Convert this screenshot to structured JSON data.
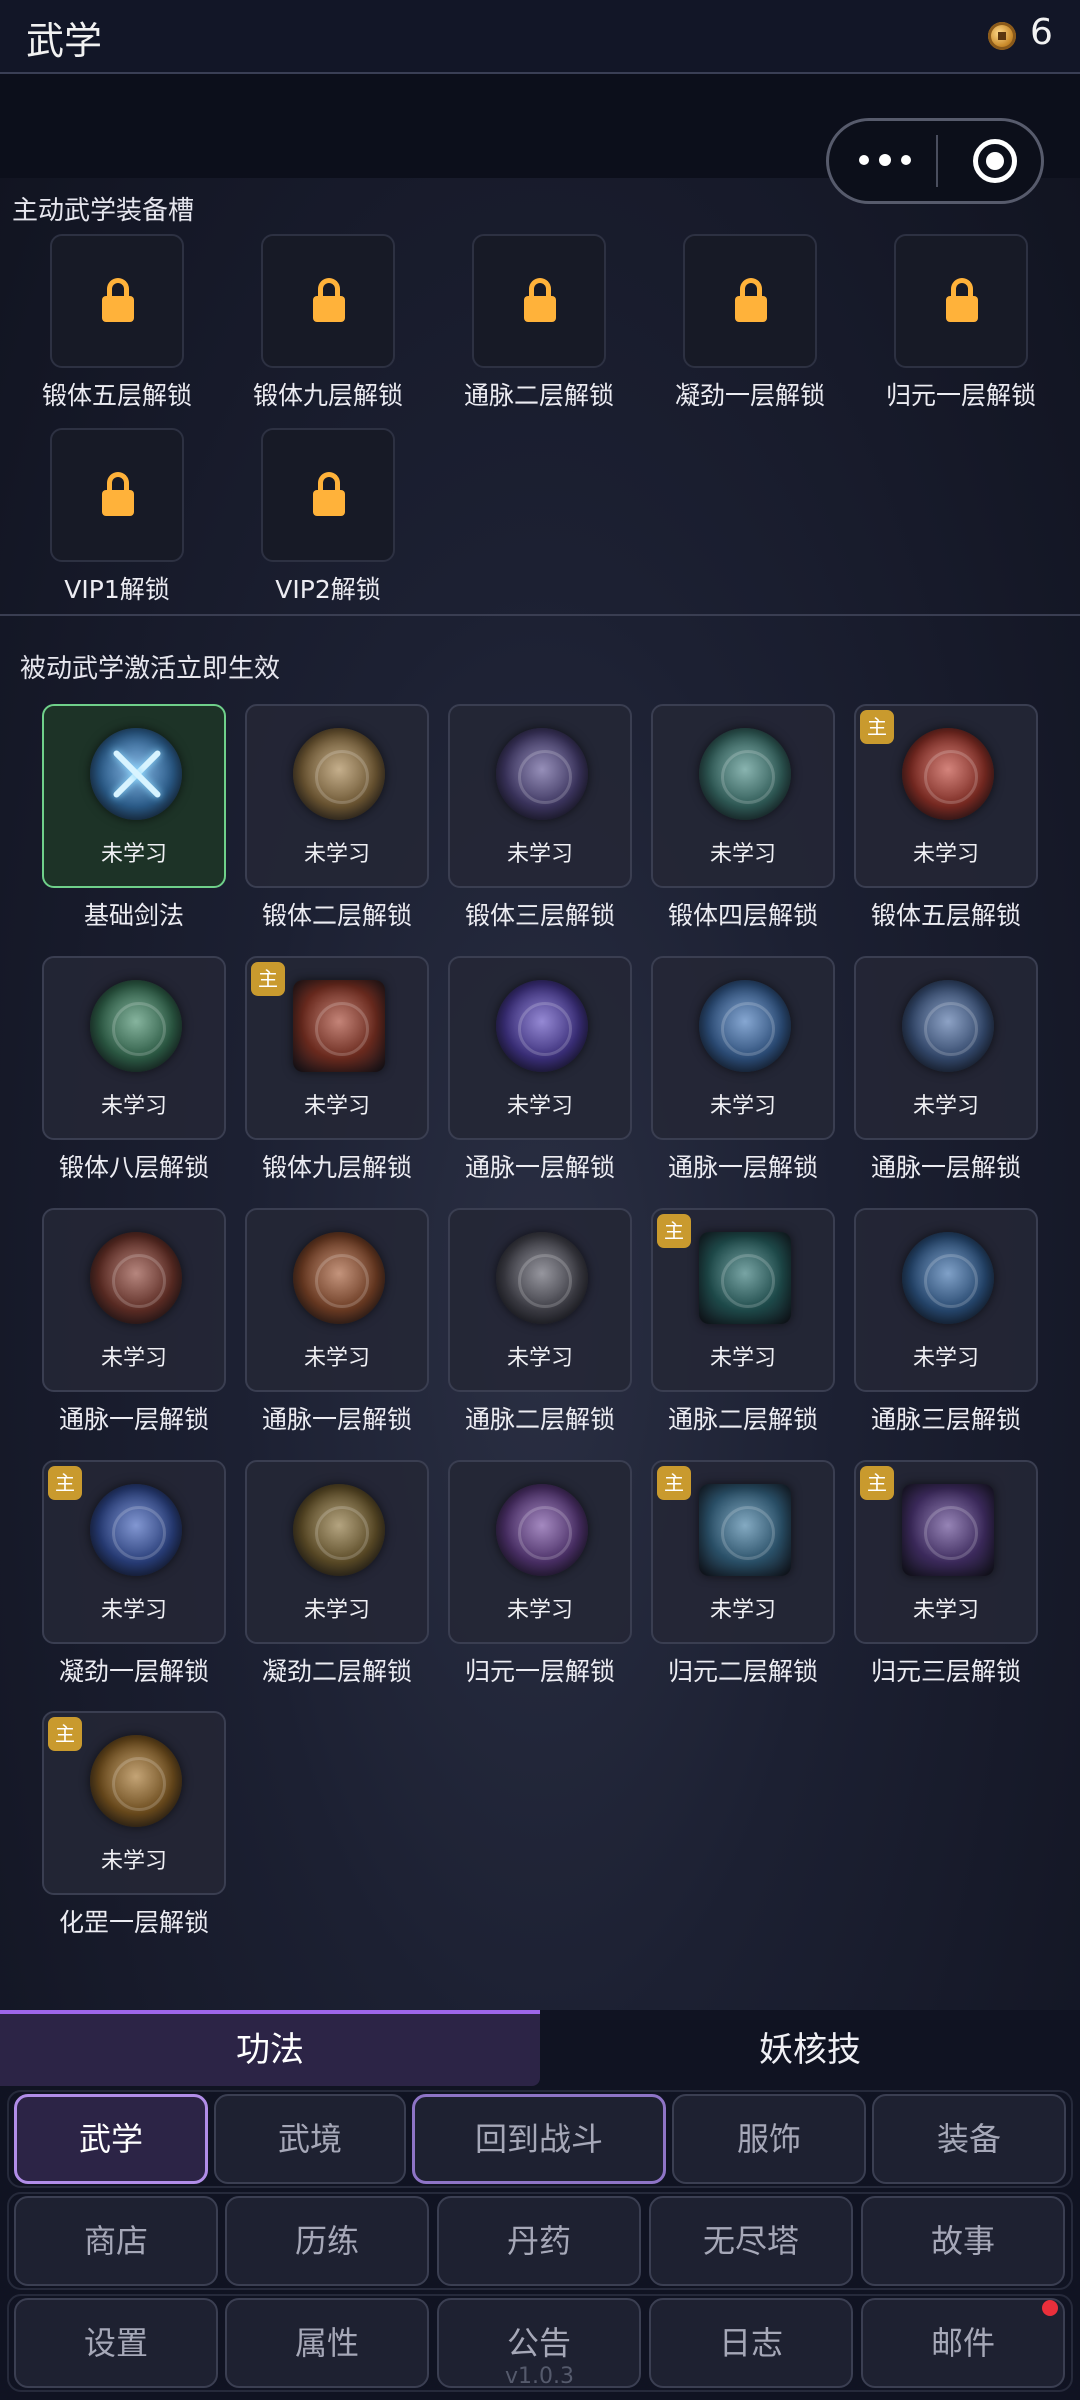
{
  "header": {
    "title": "武学",
    "coin_icon": "copper-coin-icon",
    "coin_count": "6"
  },
  "capsule": {
    "more_icon": "more-dots-icon",
    "close_icon": "target-circle-icon"
  },
  "active": {
    "title": "主动武学装备槽",
    "slots": [
      {
        "label": "锻体五层解锁"
      },
      {
        "label": "锻体九层解锁"
      },
      {
        "label": "通脉二层解锁"
      },
      {
        "label": "凝劲一层解锁"
      },
      {
        "label": "归元一层解锁"
      },
      {
        "label": "VIP1解锁"
      },
      {
        "label": "VIP2解锁"
      }
    ]
  },
  "passive": {
    "title": "被动武学激活立即生效",
    "badge_text": "主",
    "items": [
      {
        "status": "未学习",
        "label": "基础剑法",
        "icon": "crossed-swords-icon",
        "color": "#2b5c8a"
      },
      {
        "status": "未学习",
        "label": "锻体二层解锁",
        "icon": "golden-sigil-icon",
        "color": "#6b5532"
      },
      {
        "status": "未学习",
        "label": "锻体三层解锁",
        "icon": "violet-vortex-icon",
        "color": "#3c355f"
      },
      {
        "status": "未学习",
        "label": "锻体四层解锁",
        "icon": "teal-swirl-icon",
        "color": "#2f5a56"
      },
      {
        "status": "未学习",
        "label": "锻体五层解锁",
        "icon": "fire-swirl-icon",
        "color": "#7a2a22"
      },
      {
        "status": "未学习",
        "label": "锻体八层解锁",
        "icon": "green-swirl-icon",
        "color": "#2c5a44"
      },
      {
        "status": "未学习",
        "label": "锻体九层解锁",
        "icon": "flame-blades-icon",
        "color": "#6a2a1e"
      },
      {
        "status": "未学习",
        "label": "通脉一层解锁",
        "icon": "purple-vortex-icon",
        "color": "#3b2f7a"
      },
      {
        "status": "未学习",
        "label": "通脉一层解锁",
        "icon": "blue-dragon-icon",
        "color": "#2c4d78"
      },
      {
        "status": "未学习",
        "label": "通脉一层解锁",
        "icon": "blue-lotus-icon",
        "color": "#33486b"
      },
      {
        "status": "未学习",
        "label": "通脉一层解锁",
        "icon": "red-warrior-icon",
        "color": "#5c2c24"
      },
      {
        "status": "未学习",
        "label": "通脉一层解锁",
        "icon": "orange-blade-icon",
        "color": "#6a3a22"
      },
      {
        "status": "未学习",
        "label": "通脉二层解锁",
        "icon": "skeleton-icon",
        "color": "#3c3c44"
      },
      {
        "status": "未学习",
        "label": "通脉二层解锁",
        "icon": "teal-mandala-icon",
        "color": "#1e4a4a"
      },
      {
        "status": "未学习",
        "label": "通脉三层解锁",
        "icon": "blue-serpent-icon",
        "color": "#26476e"
      },
      {
        "status": "未学习",
        "label": "凝劲一层解锁",
        "icon": "lightning-rune-icon",
        "color": "#283d78"
      },
      {
        "status": "未学习",
        "label": "凝劲二层解锁",
        "icon": "sun-wheel-icon",
        "color": "#5a4a26"
      },
      {
        "status": "未学习",
        "label": "归元一层解锁",
        "icon": "purple-buddha-icon",
        "color": "#4a2f66"
      },
      {
        "status": "未学习",
        "label": "归元二层解锁",
        "icon": "ice-feather-icon",
        "color": "#2a5068"
      },
      {
        "status": "未学习",
        "label": "归元三层解锁",
        "icon": "violet-sword-icon",
        "color": "#3c2a5c"
      },
      {
        "status": "未学习",
        "label": "化罡一层解锁",
        "icon": "golden-monk-icon",
        "color": "#6a4a1c"
      }
    ]
  },
  "tabs": [
    {
      "label": "功法"
    },
    {
      "label": "妖核技"
    }
  ],
  "nav": {
    "row1": [
      {
        "label": "武学"
      },
      {
        "label": "武境"
      },
      {
        "label": "回到战斗"
      },
      {
        "label": "服饰"
      },
      {
        "label": "装备"
      }
    ],
    "row2": [
      {
        "label": "商店"
      },
      {
        "label": "历练"
      },
      {
        "label": "丹药"
      },
      {
        "label": "无尽塔"
      },
      {
        "label": "故事"
      }
    ],
    "row3": [
      {
        "label": "设置"
      },
      {
        "label": "属性"
      },
      {
        "label": "公告"
      },
      {
        "label": "日志"
      },
      {
        "label": "邮件"
      }
    ]
  },
  "version": "v1.0.3",
  "colors": {
    "accent": "#9e66ea",
    "lock": "#ffb23a",
    "badge": "#c99a2e",
    "selected_border": "#6fd08a",
    "notification": "#ea2f3b"
  }
}
